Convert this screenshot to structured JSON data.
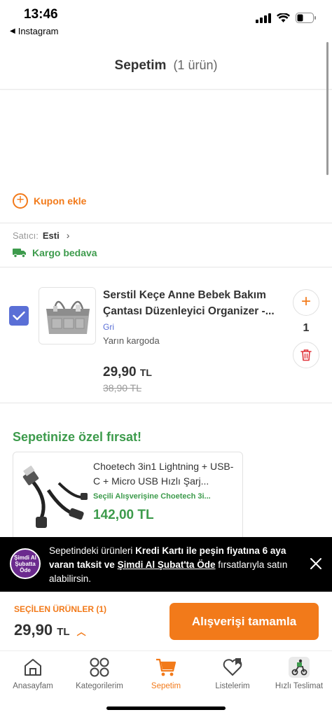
{
  "status_bar": {
    "time": "13:46",
    "back_app": "Instagram"
  },
  "header": {
    "title": "Sepetim",
    "count": "(1 ürün)"
  },
  "coupon": {
    "label": "Kupon ekle"
  },
  "seller": {
    "prefix": "Satıcı:",
    "name": "Esti"
  },
  "cargo": {
    "label": "Kargo bedava"
  },
  "product": {
    "title": "Serstil Keçe Anne Bebek Bakım Çantası Düzenleyici Organizer -...",
    "variant": "Gri",
    "shipping": "Yarın kargoda",
    "price": "29,90",
    "price_unit": "TL",
    "old_price": "38,90 TL",
    "quantity": "1",
    "checked": true
  },
  "deal": {
    "section_title": "Sepetinize özel fırsat!",
    "name": "Choetech 3in1 Lightning + USB-C + Micro USB Hızlı Şarj...",
    "promo": "Seçili Alışverişine Choetech 3i...",
    "price": "142,00 TL"
  },
  "banner": {
    "logo_line1": "Şimdi Al",
    "logo_line2": "Şubatta",
    "logo_line3": "Öde",
    "text_1": "Sepetindeki ürünleri ",
    "text_bold_1": "Kredi Kartı ile peşin fiyatına 6 aya varan taksit ve ",
    "text_link": "Şimdi Al Şubat'ta Öde",
    "text_2": " fırsatlarıyla satın alabilirsin."
  },
  "checkout": {
    "selected_label": "SEÇİLEN ÜRÜNLER (1)",
    "total": "29,90",
    "unit": "TL",
    "button_label": "Alışverişi tamamla"
  },
  "tabs": [
    {
      "label": "Anasayfam",
      "icon": "home-icon"
    },
    {
      "label": "Kategorilerim",
      "icon": "categories-icon"
    },
    {
      "label": "Sepetim",
      "icon": "cart-icon",
      "active": true
    },
    {
      "label": "Listelerim",
      "icon": "heart-list-icon"
    },
    {
      "label": "Hızlı Teslimat",
      "icon": "fast-delivery-icon"
    }
  ],
  "colors": {
    "accent": "#f27a1a",
    "green": "#3d9b4c",
    "checkbox": "#5a6fd6"
  }
}
